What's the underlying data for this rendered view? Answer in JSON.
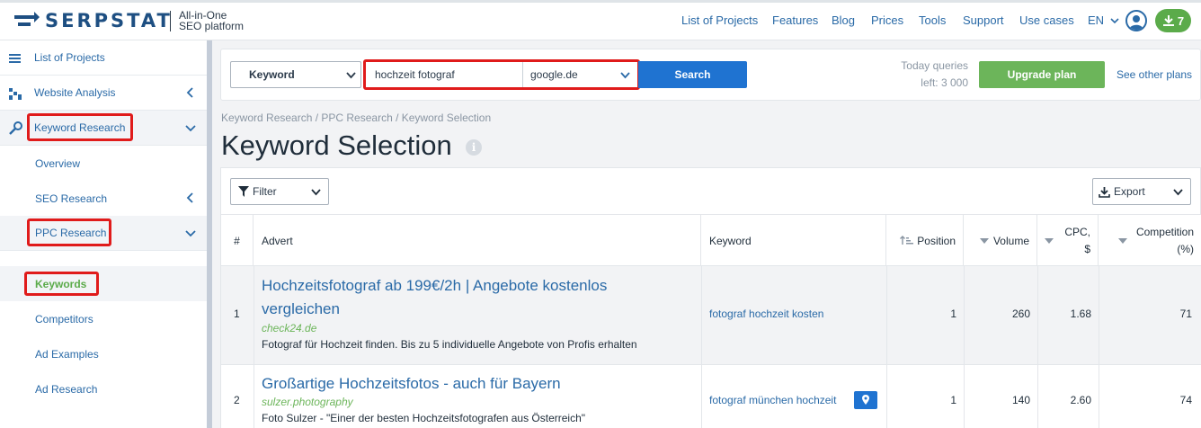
{
  "header": {
    "brand": "SERPSTAT",
    "tagline_line1": "All-in-One",
    "tagline_line2": "SEO platform",
    "nav": [
      "List of Projects",
      "Features",
      "Blog",
      "Prices",
      "Tools",
      "Support",
      "Use cases"
    ],
    "language": "EN",
    "downloads_count": "7"
  },
  "sidebar": {
    "items": [
      {
        "label": "List of Projects",
        "icon": "menu-icon"
      },
      {
        "label": "Website Analysis",
        "icon": "chart-icon"
      },
      {
        "label": "Keyword Research",
        "icon": "key-icon"
      },
      {
        "label": "Overview"
      },
      {
        "label": "SEO Research"
      },
      {
        "label": "PPC Research"
      },
      {
        "label": "Keywords"
      },
      {
        "label": "Competitors"
      },
      {
        "label": "Ad Examples"
      },
      {
        "label": "Ad Research"
      }
    ]
  },
  "search": {
    "type_label": "Keyword",
    "query": "hochzeit fotograf",
    "database": "google.de",
    "button": "Search",
    "queries_line1": "Today queries",
    "queries_line2": "left: 3 000",
    "upgrade": "Upgrade plan",
    "see_other": "See other plans"
  },
  "breadcrumb": "Keyword Research / PPC Research / Keyword Selection",
  "page_title": "Keyword Selection",
  "toolbar": {
    "filter": "Filter",
    "export": "Export"
  },
  "table": {
    "columns": {
      "num": "#",
      "advert": "Advert",
      "keyword": "Keyword",
      "position": "Position",
      "volume": "Volume",
      "cpc_line1": "CPC,",
      "cpc_line2": "$",
      "competition_line1": "Competition",
      "competition_line2": "(%)"
    },
    "rows": [
      {
        "num": "1",
        "title_line1": "Hochzeitsfotograf ab 199€/2h | Angebote kostenlos",
        "title_line2": "vergleichen",
        "url": "check24.de",
        "desc": "Fotograf für Hochzeit finden. Bis zu 5 individuelle Angebote von Profis erhalten",
        "keyword": "fotograf hochzeit kosten",
        "position": "1",
        "volume": "260",
        "cpc": "1.68",
        "competition": "71"
      },
      {
        "num": "2",
        "title_line1": "Großartige Hochzeitsfotos - auch für Bayern",
        "url": "sulzer.photography",
        "desc": "Foto Sulzer - \"Einer der besten Hochzeitsfotografen aus Österreich\"",
        "keyword": "fotograf münchen hochzeit",
        "position": "1",
        "volume": "140",
        "cpc": "2.60",
        "competition": "74"
      }
    ]
  },
  "colors": {
    "brand_blue": "#1e4f82",
    "link_blue": "#2a6aa7",
    "button_blue": "#1f73d1",
    "green": "#6cb55a",
    "highlight_red": "#e01b1b"
  }
}
